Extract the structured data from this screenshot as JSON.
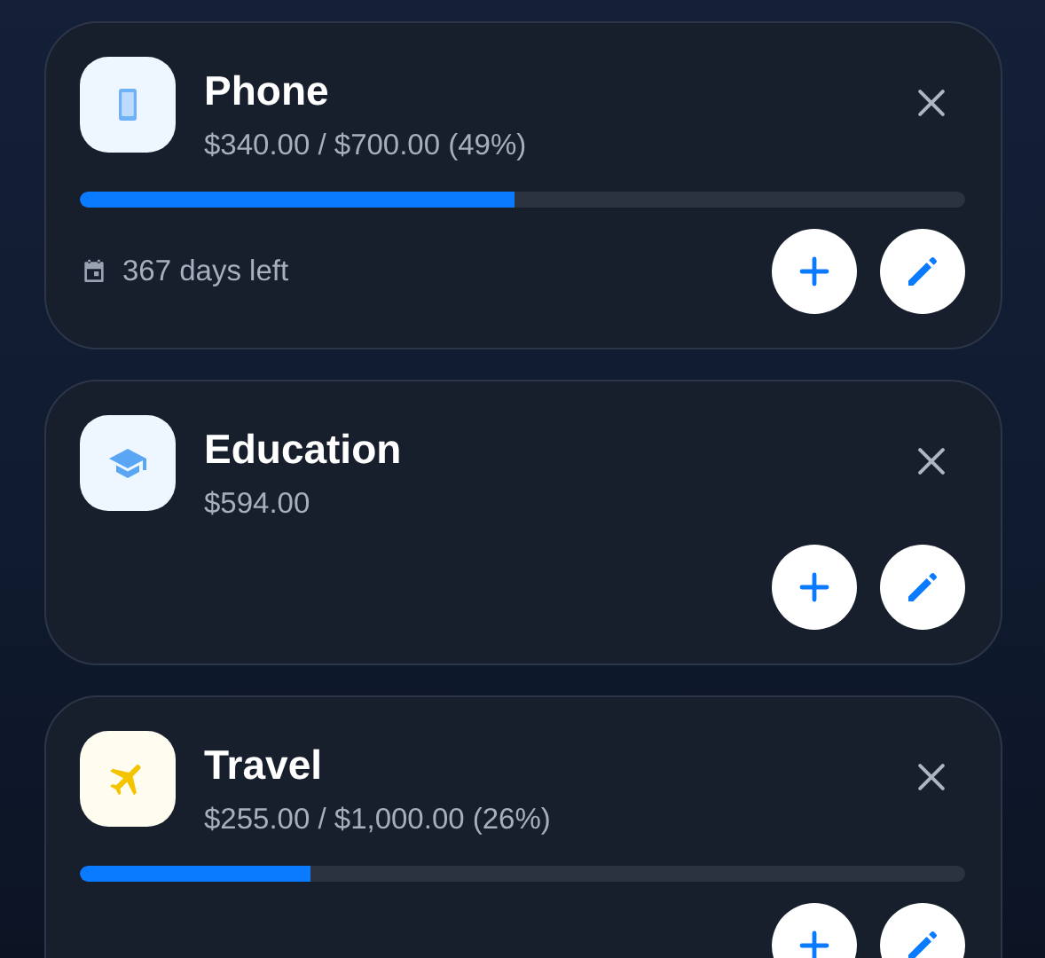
{
  "goals": [
    {
      "title": "Phone",
      "amount": "$340.00 / $700.00 (49%)",
      "progress": {
        "level": 0.49
      },
      "days_left": "367 days left"
    },
    {
      "title": "Education",
      "amount": "$594.00"
    },
    {
      "title": "Travel",
      "amount": "$255.00 / $1,000.00 (26%)",
      "progress": {
        "level": 0.26
      }
    }
  ]
}
